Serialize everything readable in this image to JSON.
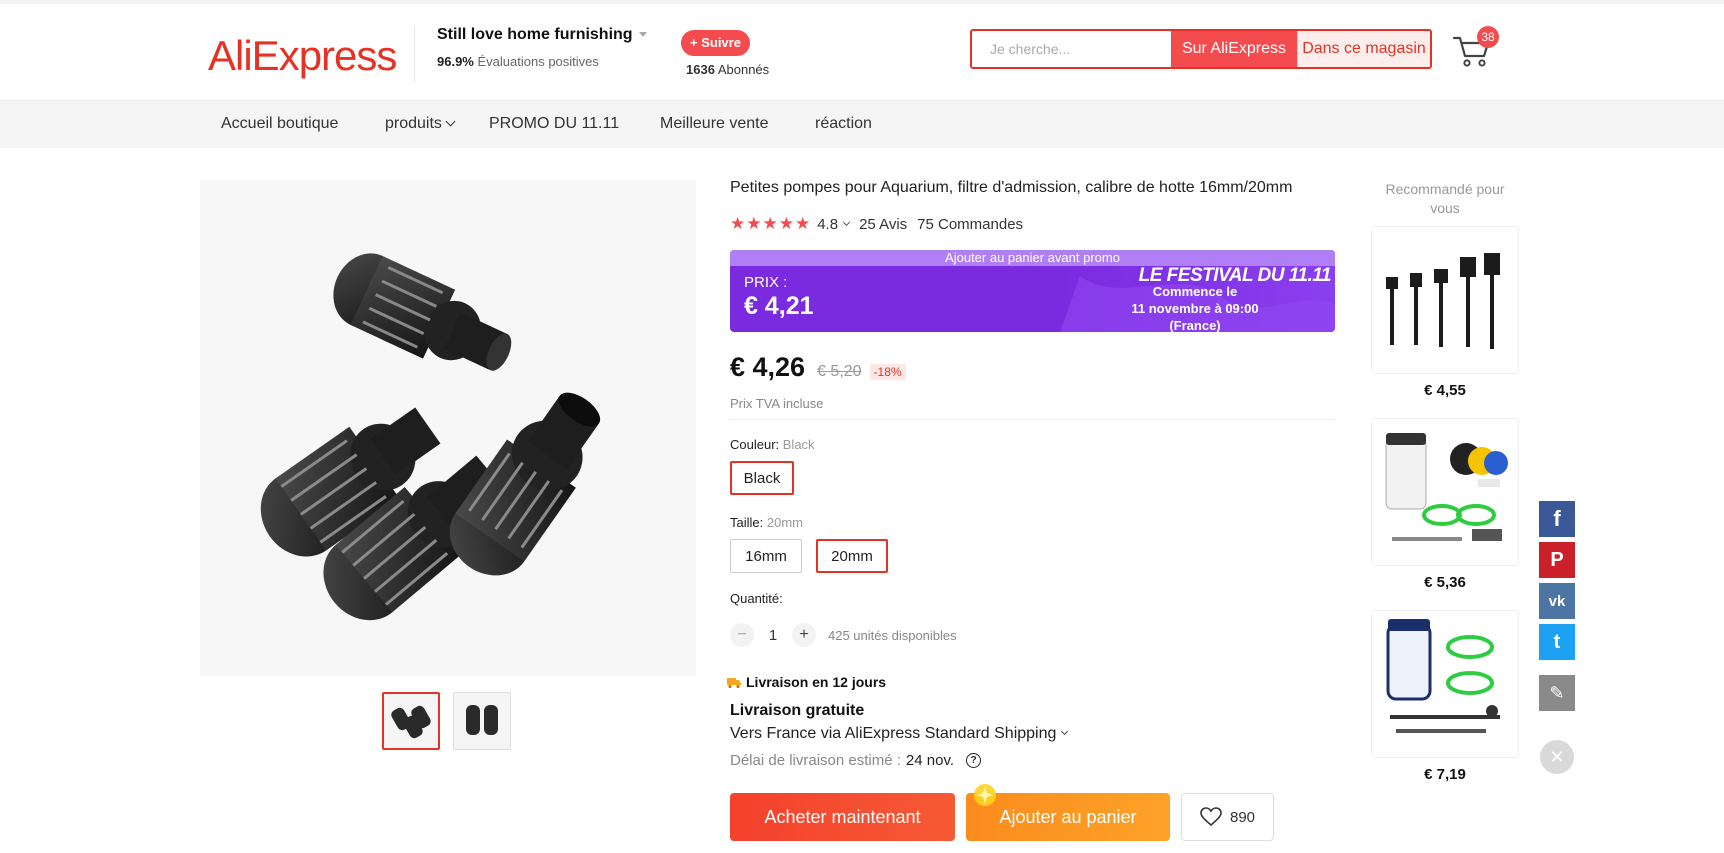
{
  "header": {
    "logo_text": "AliExpress",
    "store_name": "Still love home furnishing",
    "rating_percent": "96.9%",
    "rating_label": "Évaluations positives",
    "follow_label": "+ Suivre",
    "followers_count": "1636",
    "followers_label": "Abonnés",
    "search_placeholder": "Je cherche...",
    "search_ali_label": "Sur AliExpress",
    "search_store_label": "Dans ce magasin",
    "cart_count": "38",
    "brand_color": "#e43225"
  },
  "nav": {
    "items": [
      "Accueil boutique",
      "produits",
      "PROMO DU 11.11",
      "Meilleure vente",
      "réaction"
    ]
  },
  "product": {
    "title": "Petites pompes pour Aquarium, filtre d'admission, calibre de hotte 16mm/20mm",
    "stars": "★★★★★",
    "rating": "4.8",
    "reviews": "25 Avis",
    "orders": "75 Commandes",
    "promo": {
      "top_text": "Ajouter au panier avant promo",
      "prix_label": "PRIX :",
      "promo_price": "€ 4,21",
      "festival_text": "LE FESTIVAL DU",
      "festival_number": "11.11",
      "start_line1": "Commence le",
      "start_line2": "11 novembre à 09:00",
      "start_line3": "(France)",
      "color": "#7a2be0"
    },
    "price": "€ 4,26",
    "old_price": "€ 5,20",
    "discount": "-18%",
    "tva": "Prix TVA incluse",
    "color_label": "Couleur:",
    "color_value": "Black",
    "color_options": [
      "Black"
    ],
    "size_label": "Taille:",
    "size_value": "20mm",
    "size_options": [
      "16mm",
      "20mm"
    ],
    "quantity_label": "Quantité:",
    "quantity_minus": "−",
    "quantity_value": "1",
    "quantity_plus": "+",
    "stock": "425 unités disponibles",
    "delivery_badge": "Livraison en 12 jours",
    "free_shipping": "Livraison gratuite",
    "ship_via": "Vers France via AliExpress Standard Shipping",
    "ship_est_label": "Délai de livraison estimé :",
    "ship_est_date": "24 nov.",
    "help_icon": "?",
    "buy_now": "Acheter maintenant",
    "add_to_cart": "Ajouter au panier",
    "wishlist_count": "890"
  },
  "recommended": {
    "title": "Recommandé pour vous",
    "items": [
      {
        "price": "€ 4,55"
      },
      {
        "price": "€ 5,36"
      },
      {
        "price": "€ 7,19"
      }
    ]
  },
  "social": {
    "items": [
      {
        "name": "facebook-icon",
        "glyph": "f",
        "color": "#3b5998"
      },
      {
        "name": "pinterest-icon",
        "glyph": "P",
        "color": "#cb2027"
      },
      {
        "name": "vk-icon",
        "glyph": "vk",
        "color": "#4c75a3"
      },
      {
        "name": "twitter-icon",
        "glyph": "t",
        "color": "#1da1f2"
      },
      {
        "name": "edit-icon",
        "glyph": "✎",
        "color": "#8a8a8a"
      }
    ],
    "close_glyph": "✕"
  }
}
